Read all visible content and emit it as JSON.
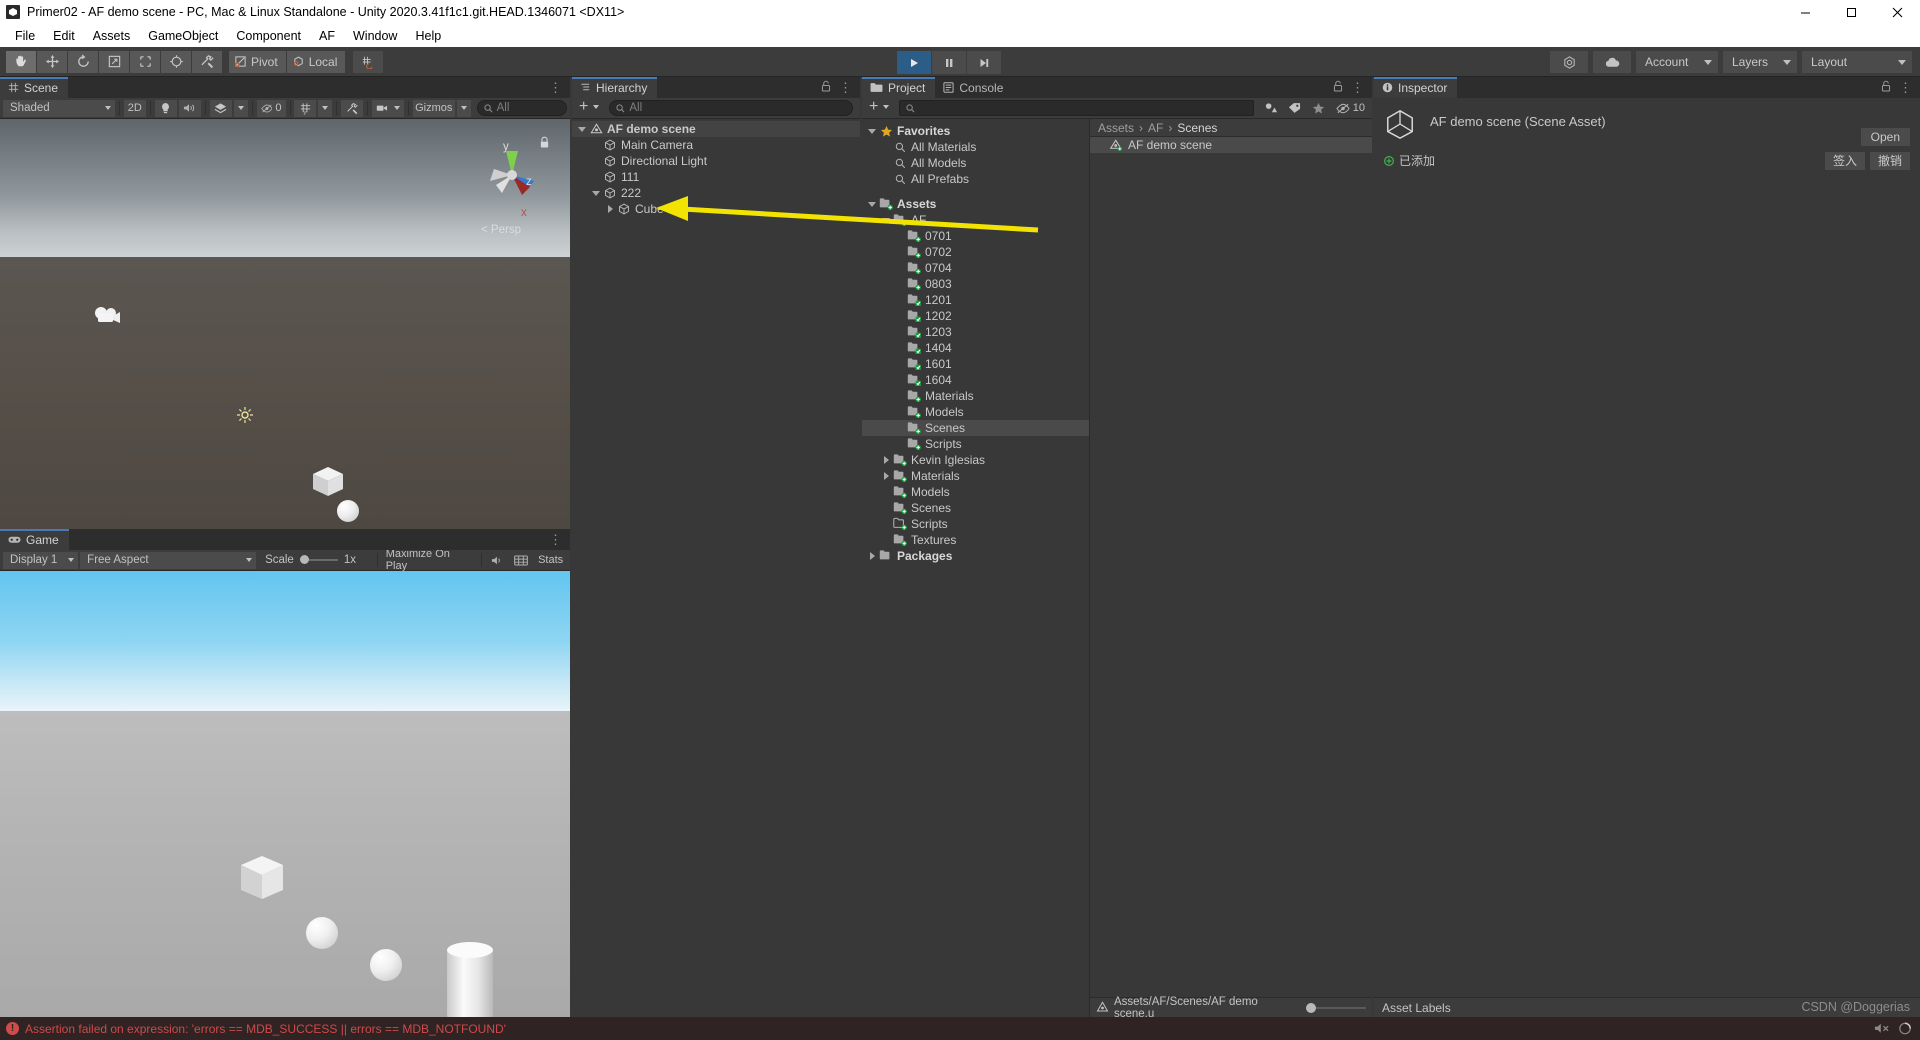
{
  "window": {
    "title": "Primer02 - AF demo scene - PC, Mac & Linux Standalone - Unity 2020.3.41f1c1.git.HEAD.1346071 <DX11>",
    "icon": "unity-icon",
    "minimize": "minimize-icon",
    "maximize": "maximize-icon",
    "close": "close-icon"
  },
  "menubar": {
    "items": [
      "File",
      "Edit",
      "Assets",
      "GameObject",
      "Component",
      "AF",
      "Window",
      "Help"
    ]
  },
  "toolbar": {
    "tools": [
      "hand-tool",
      "move-tool",
      "rotate-tool",
      "scale-tool",
      "rect-tool",
      "transform-tool",
      "custom-tool"
    ],
    "pivot_label": "Pivot",
    "local_label": "Local",
    "snap_label": "grid-snap-icon",
    "play": "play-icon",
    "pause": "pause-icon",
    "step": "step-icon",
    "collab_label": "collab-icon",
    "cloud_label": "cloud-icon",
    "account_label": "Account",
    "layers_label": "Layers",
    "layout_label": "Layout",
    "accent": "#2c5d87"
  },
  "scene": {
    "tab_label": "Scene",
    "shading_mode": "Shaded",
    "mode_2d": "2D",
    "lighting": "lighting-icon",
    "audio": "audio-icon",
    "fx": "fx-icon",
    "hidden_count": "0",
    "grid": "grid-icon",
    "tools": "tools-icon",
    "camera": "camera-icon",
    "gizmos_label": "Gizmos",
    "search_placeholder": "All",
    "persp_label": "Persp",
    "axis_y": "y",
    "axis_z": "z",
    "axis_x": "x"
  },
  "game": {
    "tab_label": "Game",
    "display_label": "Display 1",
    "aspect_label": "Free Aspect",
    "scale_label": "Scale",
    "scale_value": "1x",
    "maximize_label": "Maximize On Play",
    "mute_label": "mute-audio-icon",
    "gizmos_label": "gizmos-icon",
    "stats_label": "Stats"
  },
  "hierarchy": {
    "tab_label": "Hierarchy",
    "add_label": "+",
    "search_placeholder": "All",
    "items": [
      {
        "label": "AF demo scene",
        "icon": "scene-icon",
        "depth": 0,
        "expanded": true,
        "selected": true
      },
      {
        "label": "Main Camera",
        "icon": "gameobject-icon",
        "depth": 1,
        "expanded": null,
        "selected": false
      },
      {
        "label": "Directional Light",
        "icon": "gameobject-icon",
        "depth": 1,
        "expanded": null,
        "selected": false
      },
      {
        "label": "111",
        "icon": "gameobject-icon",
        "depth": 1,
        "expanded": null,
        "selected": false
      },
      {
        "label": "222",
        "icon": "gameobject-icon",
        "depth": 1,
        "expanded": true,
        "selected": false
      },
      {
        "label": "Cube",
        "icon": "gameobject-icon",
        "depth": 2,
        "expanded": false,
        "selected": false
      }
    ]
  },
  "project": {
    "tab_label": "Project",
    "console_tab_label": "Console",
    "search_placeholder": "",
    "filter_type": "filter-by-type-icon",
    "filter_label": "filter-by-label-icon",
    "favorite": "favorite-star-icon",
    "hidden_icon": "hidden-eye-icon",
    "hidden_count": "10",
    "tree": [
      {
        "label": "Favorites",
        "icon": "star-icon",
        "depth": 0,
        "expanded": true,
        "bold": true
      },
      {
        "label": "All Materials",
        "icon": "search-icon",
        "depth": 1,
        "expanded": null,
        "bold": false
      },
      {
        "label": "All Models",
        "icon": "search-icon",
        "depth": 1,
        "expanded": null,
        "bold": false
      },
      {
        "label": "All Prefabs",
        "icon": "search-icon",
        "depth": 1,
        "expanded": null,
        "bold": false
      },
      {
        "label": "",
        "icon": "spacer",
        "depth": 0,
        "expanded": null,
        "bold": false
      },
      {
        "label": "Assets",
        "icon": "folder-add-icon",
        "depth": 0,
        "expanded": true,
        "bold": true
      },
      {
        "label": "AF",
        "icon": "folder-add-icon",
        "depth": 1,
        "expanded": true,
        "bold": false
      },
      {
        "label": "0701",
        "icon": "folder-add-icon",
        "depth": 2,
        "expanded": null,
        "bold": false
      },
      {
        "label": "0702",
        "icon": "folder-add-icon",
        "depth": 2,
        "expanded": null,
        "bold": false
      },
      {
        "label": "0704",
        "icon": "folder-add-icon",
        "depth": 2,
        "expanded": null,
        "bold": false
      },
      {
        "label": "0803",
        "icon": "folder-add-icon",
        "depth": 2,
        "expanded": null,
        "bold": false
      },
      {
        "label": "1201",
        "icon": "folder-check-icon",
        "depth": 2,
        "expanded": null,
        "bold": false
      },
      {
        "label": "1202",
        "icon": "folder-check-icon",
        "depth": 2,
        "expanded": null,
        "bold": false
      },
      {
        "label": "1203",
        "icon": "folder-check-icon",
        "depth": 2,
        "expanded": null,
        "bold": false
      },
      {
        "label": "1404",
        "icon": "folder-check-icon",
        "depth": 2,
        "expanded": null,
        "bold": false
      },
      {
        "label": "1601",
        "icon": "folder-check-icon",
        "depth": 2,
        "expanded": null,
        "bold": false
      },
      {
        "label": "1604",
        "icon": "folder-check-icon",
        "depth": 2,
        "expanded": null,
        "bold": false
      },
      {
        "label": "Materials",
        "icon": "folder-add-icon",
        "depth": 2,
        "expanded": null,
        "bold": false
      },
      {
        "label": "Models",
        "icon": "folder-add-icon",
        "depth": 2,
        "expanded": null,
        "bold": false
      },
      {
        "label": "Scenes",
        "icon": "folder-add-icon",
        "depth": 2,
        "expanded": null,
        "bold": false,
        "selected": true
      },
      {
        "label": "Scripts",
        "icon": "folder-add-icon",
        "depth": 2,
        "expanded": null,
        "bold": false
      },
      {
        "label": "Kevin Iglesias",
        "icon": "folder-add-icon",
        "depth": 1,
        "expanded": false,
        "bold": false
      },
      {
        "label": "Materials",
        "icon": "folder-add-icon",
        "depth": 1,
        "expanded": false,
        "bold": false
      },
      {
        "label": "Models",
        "icon": "folder-add-icon",
        "depth": 1,
        "expanded": null,
        "bold": false
      },
      {
        "label": "Scenes",
        "icon": "folder-add-icon",
        "depth": 1,
        "expanded": null,
        "bold": false
      },
      {
        "label": "Scripts",
        "icon": "folder-outline-add-icon",
        "depth": 1,
        "expanded": null,
        "bold": false
      },
      {
        "label": "Textures",
        "icon": "folder-add-icon",
        "depth": 1,
        "expanded": null,
        "bold": false
      },
      {
        "label": "Packages",
        "icon": "folder-icon",
        "depth": 0,
        "expanded": false,
        "bold": true
      }
    ],
    "breadcrumb": [
      "Assets",
      "AF",
      "Scenes"
    ],
    "assets": [
      {
        "label": "AF demo scene",
        "icon": "scene-asset-icon",
        "selected": true
      }
    ],
    "status_path": "Assets/AF/Scenes/AF demo scene.u"
  },
  "inspector": {
    "tab_label": "Inspector",
    "asset_title": "AF demo scene (Scene Asset)",
    "asset_icon": "unity-scene-icon",
    "open_label": "Open",
    "vc_status": "已添加",
    "checkin_label": "签入",
    "revert_label": "撤销",
    "asset_labels_title": "Asset Labels",
    "lock_icon": "lock-icon",
    "menu_icon": "kebab-menu-icon"
  },
  "statusbar": {
    "message": "Assertion failed on expression: 'errors == MDB_SUCCESS || errors == MDB_NOTFOUND'",
    "error_icon": "error-icon",
    "color": "#cf4a4a"
  },
  "watermark": "CSDN @Doggerias",
  "annotation": {
    "arrow_color": "#f2e400",
    "description": "yellow-arrow-pointing-to-cube"
  }
}
